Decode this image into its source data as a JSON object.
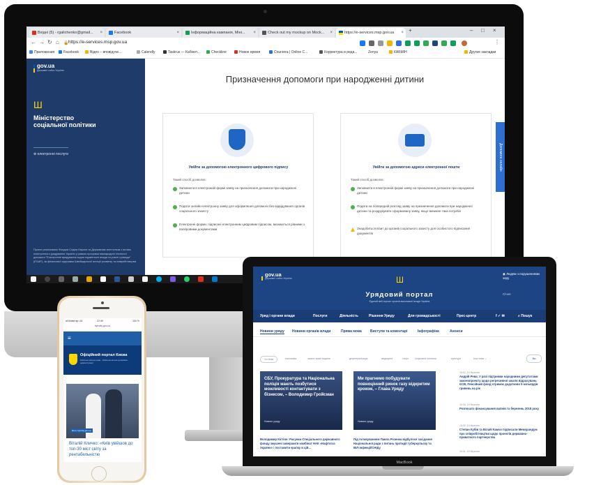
{
  "colors": {
    "gov_blue": "#1f3b6a",
    "portal_blue": "#1e4583",
    "accent_blue": "#2f6fd1",
    "ua_blue": "#0057b7",
    "ua_yellow": "#ffd500",
    "ok_green": "#4caf50"
  },
  "browser": {
    "tabs": [
      {
        "label": "Вхідні (5) - rgalichenko@gmail...",
        "icon": "gmail-icon"
      },
      {
        "label": "Facebook",
        "icon": "facebook-icon"
      },
      {
        "label": "Інформаційна кампанія, Міні...",
        "icon": "sheets-icon"
      },
      {
        "label": "Check out my mockup on Mock...",
        "icon": "mockup-icon"
      },
      {
        "label": "https://e-services.msp.gov.ua",
        "icon": "ua-flag-icon"
      }
    ],
    "url": "https://e-services.msp.gov.ua",
    "bookmarks": [
      "Приложения",
      "Facebook",
      "Відео – вповідуче...",
      "Calendly",
      "Taskrus — Кабінет...",
      "Checkline",
      "Новое время",
      "Coursera | Online C...",
      "Корректура и реда...",
      "Zenya",
      "КАБМІН",
      "Другие закладки"
    ]
  },
  "msp": {
    "gov_label": "gov.ua",
    "gov_sub": "Державні сайти України",
    "ministry": "Міністерство соціальної політики",
    "eservices": "електронні послуги",
    "footer": "Проект реалізовано Фондом Східна Європа та Державним агентством з питань електронного урядування України у рамках програми міжнародної технічної допомоги \"Електронне врядування задля підзвітності влади та участі громади\" (EGAP), за фінансової підтримки Швейцарської агенції розвитку та співробітництва",
    "title": "Призначення допомоги при народженні дитини",
    "feedback": "Допомога онлайн",
    "cards": [
      {
        "title": "Увійти за допомогою електронного цифрового підпису",
        "subtitle": "Такий спосіб дозволяє:",
        "items": [
          "Заповнити в електронній формі заяву на призначення допомоги при народженні дитини",
          "Подати онлайн-електронну заяву для оформлення допомоги без відвідування органів соціального захисту",
          "Електронні форми, підписані електронним цифровим підписом, визнаються рівними з паперовими документами"
        ]
      },
      {
        "title": "Увійти за допомогою адреси електронної пошти",
        "subtitle": "Такий спосіб дозволяє:",
        "items": [
          "Заповнити в електронній формі заяву на призначення допомоги при народженні дитини",
          "Подати на попередній розгляд заяву на призначення допомоги при народженні дитини та роздрукувати сформовану заяву, якщо виникне така потреба",
          "Знадобиться візит до органів соціального захисту для особистого підписання документів"
        ]
      }
    ]
  },
  "portal": {
    "gov_label": "gov.ua",
    "gov_sub": "Державні сайти України",
    "title": "Урядовий портал",
    "subtitle": "Єдиний веб-портал органів виконавчої влади України",
    "eye_label": "Людям з порушеннями зору",
    "login": "Січня",
    "nav": [
      "Уряд і органи влади",
      "Послуги",
      "Діяльність",
      "Рішення Уряду",
      "Для громадськості",
      "Прес-центр",
      "Пошук"
    ],
    "tabs": [
      "Новини уряду",
      "Новини органів влади",
      "Пряма мова",
      "Виступи та коментарі",
      "Інфографіка",
      "Анонси"
    ],
    "pills": [
      "Усі теми",
      "економіка",
      "захист прав людини",
      "децентралізація",
      "медицина",
      "спорт",
      "соціальна політика",
      "культура",
      "Інші теми"
    ],
    "search": "Всі",
    "news": [
      {
        "headline": "СБУ, Прокуратура та Національна поліція мають позбутися можливості контактувати з бізнесом, – Володимир Гройсман",
        "label": "Новини уряду",
        "caption": "Володимир Кістіон: Рахунки Спеціального державного фонду змушені завершити комбінат НАК «Нафтогаз України» і поставити крапку в цій..."
      },
      {
        "headline": "Ми прагнемо побудувати повноцінний ринок газу відкритим кроком, – Глава Уряду",
        "label": "Новини уряду",
        "caption": "Під головуванням Павла Розенка відбулося засідання Національної ради з питань протидії туберкульозу та ВІЛ-інфекції/СНІДу"
      }
    ],
    "side": [
      {
        "date": "18:02, 19 березня",
        "text": "Андрій Рева: У разі підтримки народними депутатами законопроекту щодо регресивної шкали відрахувань ЄСВ, Пенсійний фонд отримає додатково 5 мільярдів гривень на рік"
      },
      {
        "date": "16:34, 19 березня",
        "text": "Розпочато фінансування вапнів та березень 2018 року"
      },
      {
        "date": "16:32, 19 березня",
        "text": "Степан Кубів та Вілайі Камчо підписали Меморандум про співробітництво щодо проектів державно-приватного партнерства"
      },
      {
        "date": "16:31, 19 березня",
        "text": ""
      }
    ],
    "device": "MacBook"
  },
  "phone": {
    "status_left": "all Київстар UA",
    "status_time": "22:49",
    "status_right": "100 %",
    "url": "kyivcity.gov.ua",
    "portal_title": "Офіційний портал Києва",
    "portal_sub": "Київська міська рада · Київська міська державна адміністрація",
    "photo_badge": "Фото: kyivcity.gov.ua",
    "headline": "Віталій Кличко: «Київ увійшов до топ-30 міст світу за рентабельністю"
  }
}
